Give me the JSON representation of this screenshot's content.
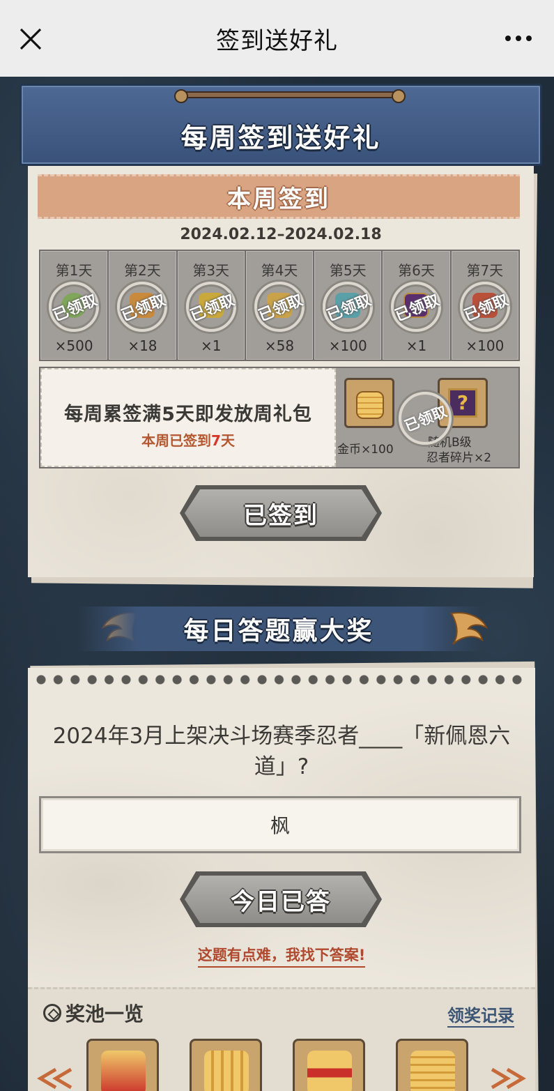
{
  "topbar": {
    "title": "签到送好礼",
    "close_icon": "close-icon",
    "more_icon": "more-dots-icon"
  },
  "weekly": {
    "header_title": "每周签到送好礼",
    "band_title": "本周签到",
    "date_range": "2024.02.12–2024.02.18",
    "claimed_stamp": "已领取",
    "days": [
      {
        "label": "第1天",
        "qty": "×500",
        "item_color": "#7fa65a"
      },
      {
        "label": "第2天",
        "qty": "×18",
        "item_color": "#c98a3c"
      },
      {
        "label": "第3天",
        "qty": "×1",
        "item_color": "#c9a83c"
      },
      {
        "label": "第4天",
        "qty": "×58",
        "item_color": "#c9a24a"
      },
      {
        "label": "第5天",
        "qty": "×100",
        "item_color": "#5aa0a8"
      },
      {
        "label": "第6天",
        "qty": "×1",
        "item_color": "#5a2e6e"
      },
      {
        "label": "第7天",
        "qty": "×100",
        "item_color": "#b8503a"
      }
    ],
    "bonus": {
      "line1": "每周累签满5天即发放周礼包",
      "line2_prefix": "本周已签到",
      "line2_num": "7",
      "line2_suffix": "天",
      "reward1_label": "金币×100",
      "reward2_label_1": "随机B级",
      "reward2_label_2": "忍者碎片×2",
      "stamp": "已领取"
    },
    "button_label": "已签到"
  },
  "quiz": {
    "banner_title": "每日答题赢大奖",
    "question": "2024年3月上架决斗场赛季忍者____「新佩恩六道」?",
    "answer": "枫",
    "button_label": "今日已答",
    "hint": "这题有点难，我找下答案!",
    "pool_title": "奖池一览",
    "records_link": "领奖记录"
  },
  "colors": {
    "accent_blue": "#3d5578",
    "paper": "#ece7dd",
    "band": "#d9a482",
    "highlight_red": "#d8372a"
  }
}
